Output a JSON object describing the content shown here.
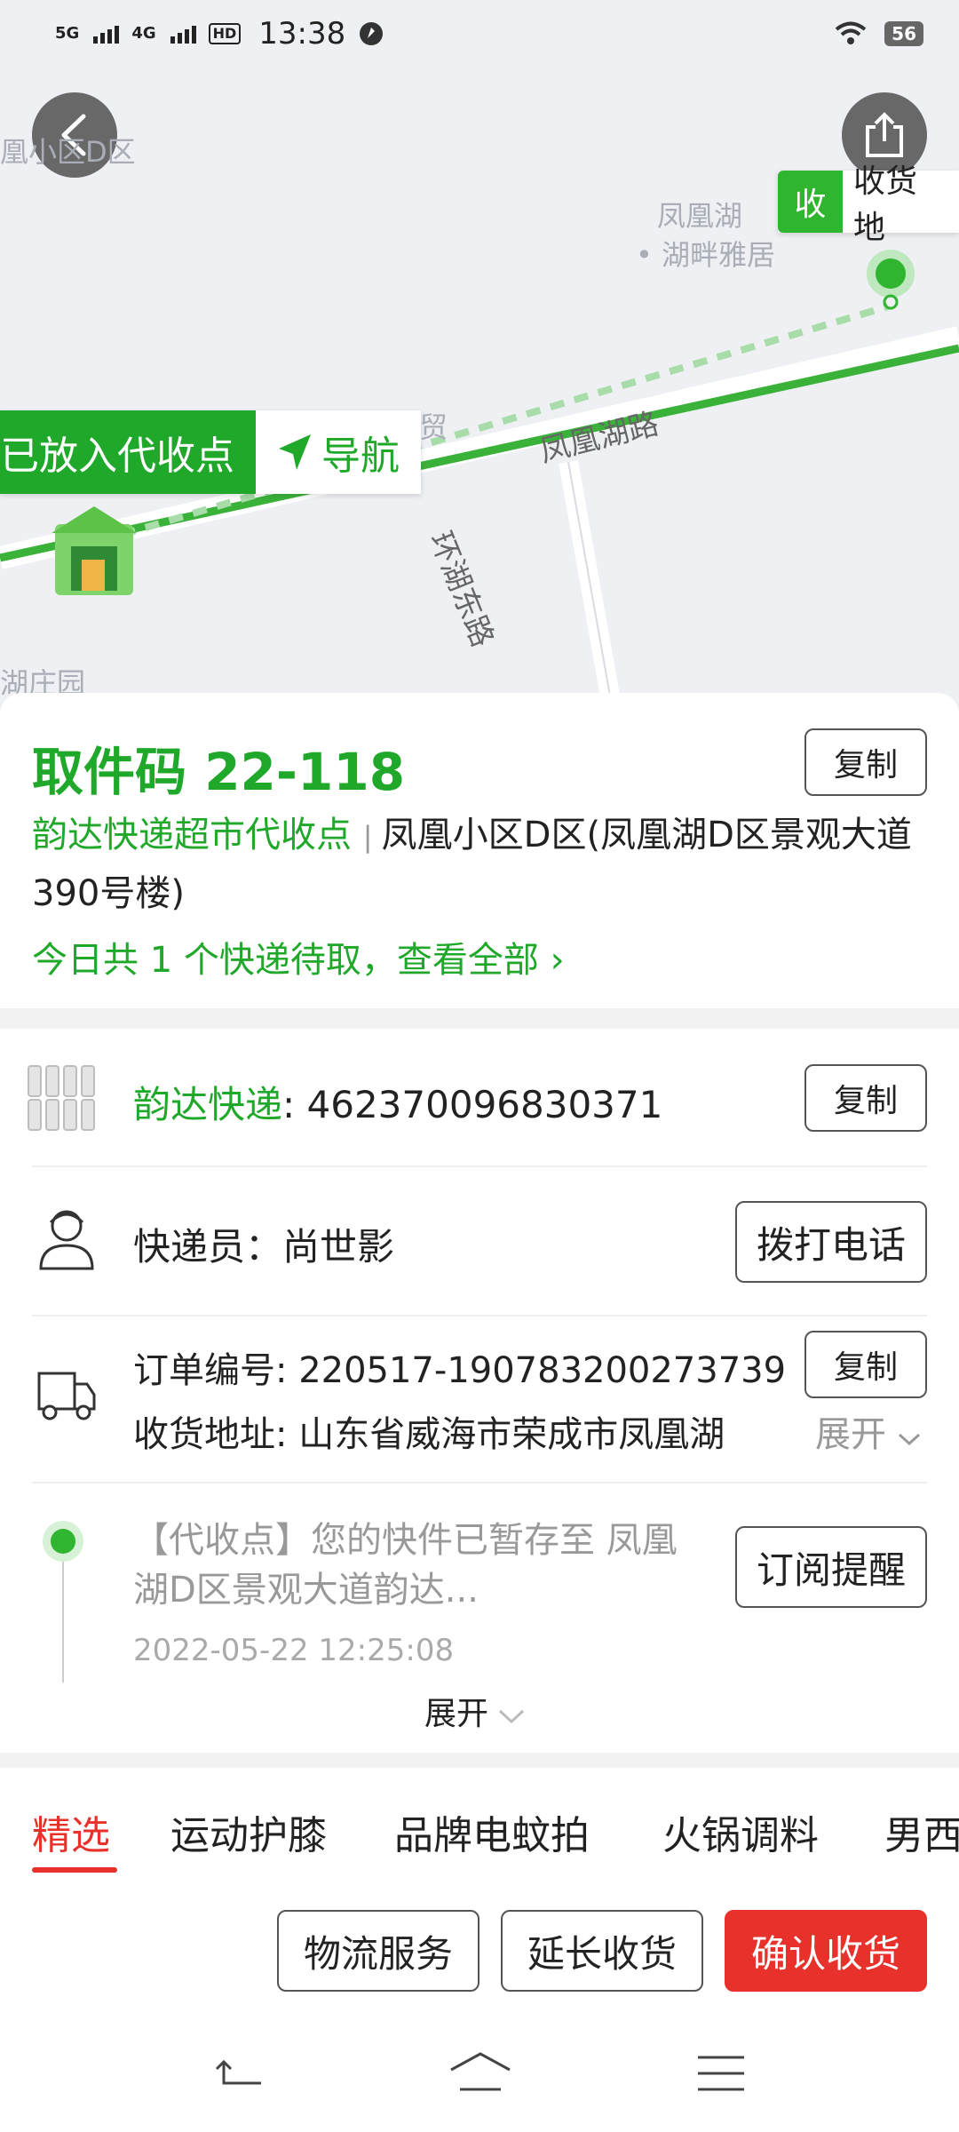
{
  "status_bar": {
    "signal1": "5G",
    "signal2": "4G",
    "hd": "HD",
    "time": "13:38",
    "battery": "56"
  },
  "map": {
    "area_labels": [
      "凰小区D区",
      "凤凰湖",
      "湖畔雅居",
      "商贸",
      "湖庄园"
    ],
    "road_labels": [
      "凤凰湖路",
      "环湖东路"
    ],
    "destination_badge": "收",
    "destination_label": "收货地",
    "pickup_status": "已放入代收点",
    "navigate_label": "导航"
  },
  "pickup": {
    "code_label": "取件码 22-118",
    "copy_label": "复制",
    "station": "韵达快递超市代收点",
    "address": "凤凰小区D区(凤凰湖D区景观大道390号楼)",
    "summary": "今日共 1 个快递待取，查看全部"
  },
  "details": {
    "carrier": "韵达快递",
    "tracking_number": ": 462370096830371",
    "copy_label": "复制",
    "courier_label": "快递员：尚世影",
    "call_label": "拨打电话",
    "order_label": "订单编号: 220517-190783200273739",
    "order_copy_label": "复制",
    "address_label": "收货地址: 山东省威海市荣成市凤凰湖",
    "expand_label": "展开",
    "track_text": "【代收点】您的快件已暂存至 凤凰湖D区景观大道韵达...",
    "track_time": "2022-05-22 12:25:08",
    "subscribe_label": "订阅提醒",
    "track_expand_label": "展开"
  },
  "tabs": [
    "精选",
    "运动护膝",
    "品牌电蚊拍",
    "火锅调料",
    "男西"
  ],
  "actions": {
    "logistics": "物流服务",
    "extend": "延长收货",
    "confirm": "确认收货"
  },
  "colors": {
    "accent_green": "#1fa82a",
    "accent_red": "#e8312b"
  }
}
